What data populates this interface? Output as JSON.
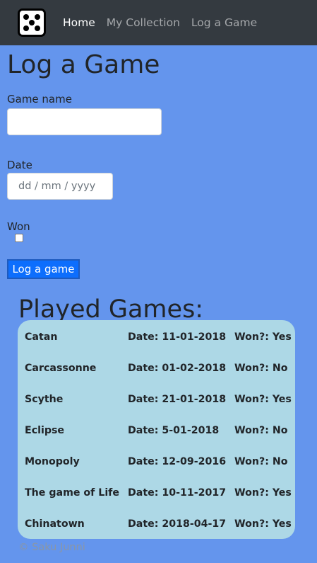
{
  "nav": {
    "links": [
      {
        "label": "Home",
        "active": true
      },
      {
        "label": "My Collection",
        "active": false
      },
      {
        "label": "Log a Game",
        "active": false
      }
    ]
  },
  "form": {
    "title": "Log a Game",
    "game_name_label": "Game name",
    "game_name_value": "",
    "date_label": "Date",
    "date_placeholder": "dd / mm / yyyy",
    "won_label": "Won",
    "won_checked": false,
    "submit_label": "Log a game"
  },
  "played": {
    "title": "Played Games:",
    "games": [
      {
        "name": "Catan",
        "date": "Date: 11-01-2018",
        "won": "Won?: Yes"
      },
      {
        "name": "Carcassonne",
        "date": "Date: 01-02-2018",
        "won": "Won?: No"
      },
      {
        "name": "Scythe",
        "date": "Date: 21-01-2018",
        "won": "Won?: Yes"
      },
      {
        "name": "Eclipse",
        "date": "Date: 5-01-2018",
        "won": "Won?: No"
      },
      {
        "name": "Monopoly",
        "date": "Date: 12-09-2016",
        "won": "Won?: No"
      },
      {
        "name": "The game of Life",
        "date": "Date: 10-11-2017",
        "won": "Won?: Yes"
      },
      {
        "name": "Chinatown",
        "date": "Date: 2018-04-17",
        "won": "Won?: Yes"
      }
    ]
  },
  "footer": {
    "text": "© Saku Junni"
  },
  "colors": {
    "page_background": "#6495ed",
    "navbar": "#343a40",
    "card": "#add8e6",
    "button": "#0d6efd"
  },
  "icons": {
    "logo": "dice-five-icon"
  }
}
